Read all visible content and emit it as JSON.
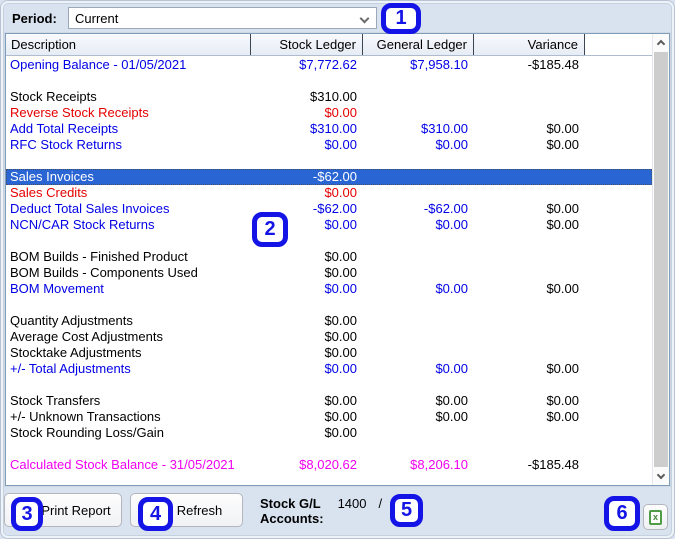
{
  "period": {
    "label": "Period:",
    "value": "Current"
  },
  "table": {
    "columns": [
      "Description",
      "Stock Ledger",
      "General Ledger",
      "Variance"
    ],
    "rows": [
      {
        "label": "Opening Balance - 01/05/2021",
        "stock": "$7,772.62",
        "general": "$7,958.10",
        "variance": "-$185.48",
        "color": "blue"
      },
      {
        "blank": true
      },
      {
        "label": "Stock Receipts",
        "stock": "$310.00",
        "general": "",
        "variance": "",
        "color": "black"
      },
      {
        "label": "Reverse Stock Receipts",
        "stock": "$0.00",
        "general": "",
        "variance": "",
        "color": "red"
      },
      {
        "label": "Add Total Receipts",
        "stock": "$310.00",
        "general": "$310.00",
        "variance": "$0.00",
        "color": "blue"
      },
      {
        "label": "RFC Stock Returns",
        "stock": "$0.00",
        "general": "$0.00",
        "variance": "$0.00",
        "color": "blue"
      },
      {
        "blank": true
      },
      {
        "label": "Sales Invoices",
        "stock": "-$62.00",
        "general": "",
        "variance": "",
        "color": "black",
        "selected": true
      },
      {
        "label": "Sales Credits",
        "stock": "$0.00",
        "general": "",
        "variance": "",
        "color": "red"
      },
      {
        "label": "Deduct Total Sales Invoices",
        "stock": "-$62.00",
        "general": "-$62.00",
        "variance": "$0.00",
        "color": "blue"
      },
      {
        "label": "NCN/CAR Stock Returns",
        "stock": "$0.00",
        "general": "$0.00",
        "variance": "$0.00",
        "color": "blue"
      },
      {
        "blank": true
      },
      {
        "label": "BOM Builds - Finished Product",
        "stock": "$0.00",
        "general": "",
        "variance": "",
        "color": "black"
      },
      {
        "label": "BOM Builds - Components Used",
        "stock": "$0.00",
        "general": "",
        "variance": "",
        "color": "black"
      },
      {
        "label": "BOM Movement",
        "stock": "$0.00",
        "general": "$0.00",
        "variance": "$0.00",
        "color": "blue"
      },
      {
        "blank": true
      },
      {
        "label": "Quantity Adjustments",
        "stock": "$0.00",
        "general": "",
        "variance": "",
        "color": "black"
      },
      {
        "label": "Average Cost Adjustments",
        "stock": "$0.00",
        "general": "",
        "variance": "",
        "color": "black"
      },
      {
        "label": "Stocktake Adjustments",
        "stock": "$0.00",
        "general": "",
        "variance": "",
        "color": "black"
      },
      {
        "label": "+/- Total Adjustments",
        "stock": "$0.00",
        "general": "$0.00",
        "variance": "$0.00",
        "color": "blue"
      },
      {
        "blank": true
      },
      {
        "label": "Stock Transfers",
        "stock": "$0.00",
        "general": "$0.00",
        "variance": "$0.00",
        "color": "black"
      },
      {
        "label": "+/- Unknown Transactions",
        "stock": "$0.00",
        "general": "$0.00",
        "variance": "$0.00",
        "color": "black"
      },
      {
        "label": "Stock Rounding Loss/Gain",
        "stock": "$0.00",
        "general": "",
        "variance": "",
        "color": "black"
      },
      {
        "blank": true
      },
      {
        "label": "Calculated Stock Balance - 31/05/2021",
        "stock": "$8,020.62",
        "general": "$8,206.10",
        "variance": "-$185.48",
        "color": "magenta"
      }
    ]
  },
  "footer": {
    "print_button": "Print Report",
    "refresh_button": "Refresh",
    "stock_gl_label_line1": "Stock G/L",
    "stock_gl_label_line2": "Accounts:",
    "stock_gl_value": "1400",
    "stock_gl_separator": "/"
  },
  "callouts": [
    "1",
    "2",
    "3",
    "4",
    "5",
    "6"
  ],
  "icons": {
    "dropdown": "chevron-down-icon",
    "scroll_up": "chevron-up-icon",
    "scroll_down": "chevron-down-icon",
    "export": "excel-export-icon"
  },
  "colors": {
    "background": "#d9e3f0",
    "row_blue": "#0000e6",
    "row_red": "#e60000",
    "row_magenta": "#f000f0",
    "selected_row_bg": "#2a65d4",
    "selected_row_text": "#ffffff",
    "callout_blue": "#1414e6",
    "excel_green": "#4f9d46"
  }
}
